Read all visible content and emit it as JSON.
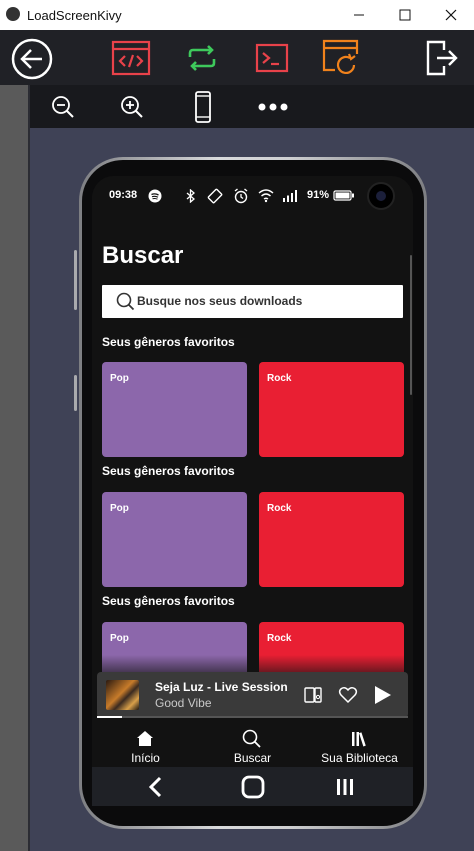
{
  "window": {
    "title": "LoadScreenKivy",
    "icon": "kivy-icon",
    "buttons": [
      "minimize-icon",
      "maximize-icon",
      "close-icon"
    ]
  },
  "toolbar": {
    "items": [
      "back-arrow-icon",
      "code-icon",
      "reload-icon",
      "terminal-icon",
      "refresh-window-icon",
      "exit-icon"
    ],
    "colors": {
      "code": "#e8424a",
      "reload": "#3ec95c",
      "terminal": "#e8424a",
      "refresh": "#f0821c",
      "white": "#ffffff"
    }
  },
  "subtoolbar": {
    "items": [
      "zoom-out-icon",
      "zoom-in-icon",
      "phone-icon",
      "more-icon"
    ]
  },
  "phone": {
    "status": {
      "time": "09:38",
      "battery": "91%",
      "icons": [
        "spotify-icon",
        "bluetooth-icon",
        "vibrate-icon",
        "alarm-icon",
        "wifi-icon",
        "signal-icon",
        "battery-icon"
      ]
    },
    "screen": {
      "title": "Buscar",
      "search_placeholder": "Busque nos seus downloads",
      "sections": [
        {
          "title": "Seus gêneros favoritos",
          "tiles": [
            "Pop",
            "Rock"
          ]
        },
        {
          "title": "Seus gêneros favoritos",
          "tiles": [
            "Pop",
            "Rock"
          ]
        },
        {
          "title": "Seus gêneros favoritos",
          "tiles": [
            "Pop",
            "Rock"
          ]
        }
      ],
      "colors": {
        "pop": "#8c67ab",
        "rock": "#e91f33",
        "background": "#121212"
      }
    },
    "player": {
      "song": "Seja Luz - Live Session",
      "artist": "Good Vibe",
      "progress": 0.08,
      "icons": [
        "devices-icon",
        "heart-icon",
        "play-icon"
      ]
    },
    "nav": [
      {
        "label": "Início",
        "icon": "home-icon"
      },
      {
        "label": "Buscar",
        "icon": "search-icon"
      },
      {
        "label": "Sua Biblioteca",
        "icon": "library-icon"
      }
    ],
    "system_nav": [
      "back-icon",
      "home-button-icon",
      "recents-icon"
    ]
  }
}
